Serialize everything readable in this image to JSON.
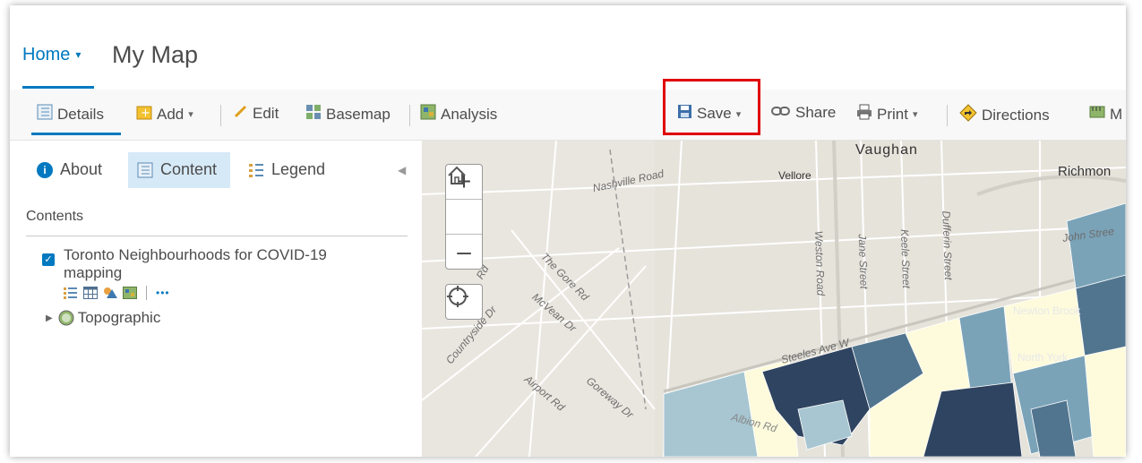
{
  "header": {
    "home_label": "Home",
    "home_caret": "▾",
    "title": "My Map"
  },
  "toolbar": {
    "details": "Details",
    "add": "Add",
    "edit": "Edit",
    "basemap": "Basemap",
    "analysis": "Analysis",
    "save": "Save",
    "share": "Share",
    "print": "Print",
    "directions": "Directions",
    "more": "M",
    "dropdown_caret": "▾"
  },
  "panel": {
    "tabs": [
      {
        "label": "About"
      },
      {
        "label": "Content"
      },
      {
        "label": "Legend"
      }
    ],
    "contents_label": "Contents",
    "layer": {
      "name": "Toronto Neighbourhoods for COVID-19 mapping",
      "checked": true,
      "more": "•••"
    },
    "basemap_layer": "Topographic"
  },
  "map": {
    "controls": {
      "zoom_in": "+",
      "zoom_out": "–"
    },
    "places": [
      "Vaughan",
      "Vellore",
      "Richmon",
      "Newton Brook",
      "North York"
    ],
    "streets": [
      "Nashville Road",
      "The Gore Rd",
      "McVean Dr",
      "Countryside Dr",
      "Airport Rd",
      "Goreway Dr",
      "Weston Road",
      "Jane Street",
      "Keele Street",
      "Dufferin Street",
      "John Stree",
      "Steeles Ave W",
      "Albion Rd",
      "Rd"
    ]
  },
  "colors": {
    "accent": "#0079c1",
    "highlight": "#e00000",
    "map_base": "#e8e4dc",
    "choropleth": [
      "#fdfbdc",
      "#a7c6d1",
      "#7aa3b8",
      "#52758f",
      "#2f4460"
    ]
  }
}
